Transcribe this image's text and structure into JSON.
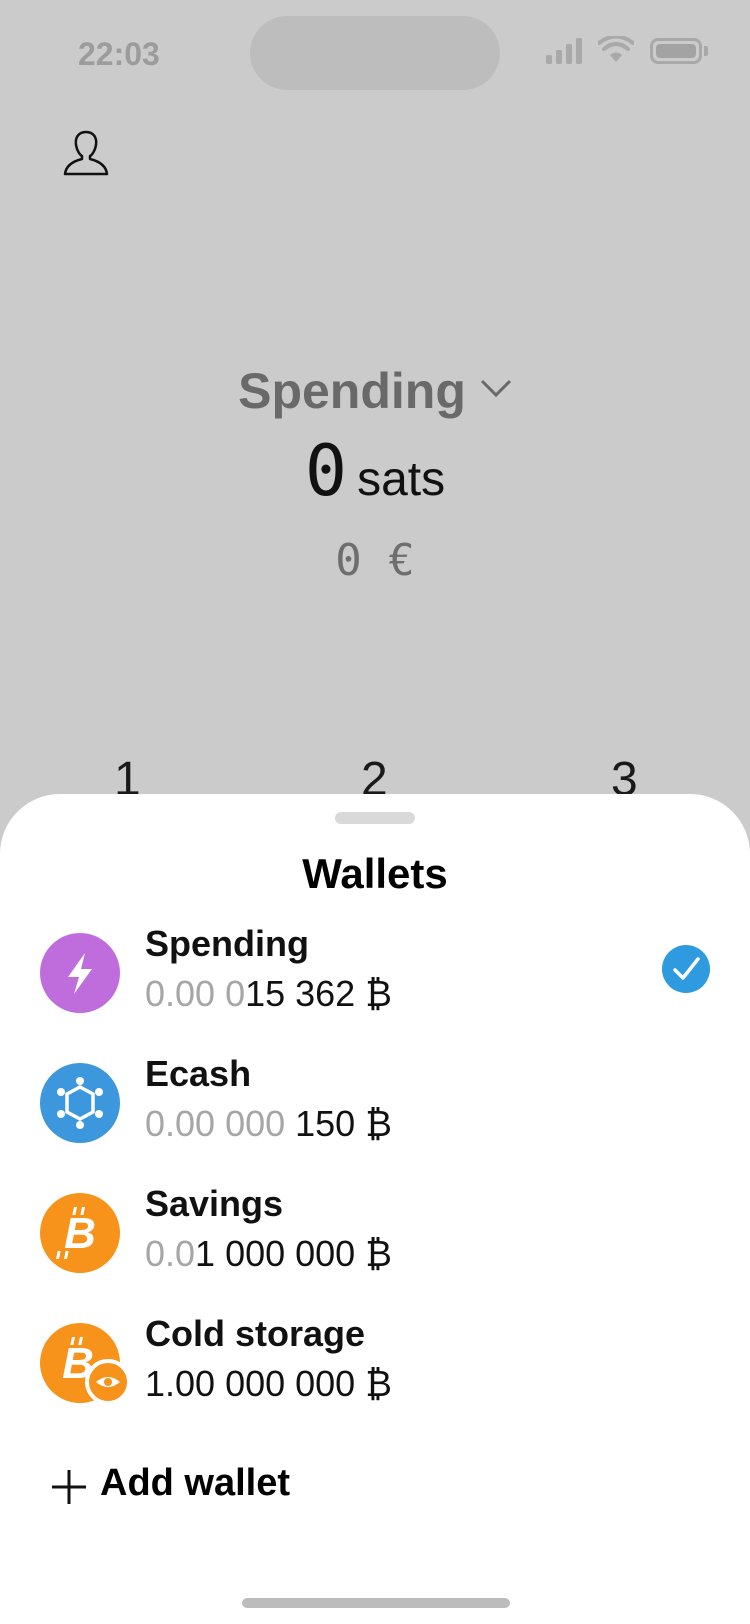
{
  "status_bar": {
    "time": "22:03"
  },
  "header": {
    "wallet_name": "Spending"
  },
  "balance": {
    "amount": "0",
    "unit": "sats",
    "fiat": "0 €"
  },
  "keypad": {
    "digits": [
      "1",
      "2",
      "3"
    ]
  },
  "sheet": {
    "title": "Wallets",
    "wallets": [
      {
        "name": "Spending",
        "amount_dim": "0.00 0",
        "amount_main": "15 362 ₿",
        "icon": "lightning-icon",
        "color": "#bf6ddc",
        "selected": true
      },
      {
        "name": "Ecash",
        "amount_dim": "0.00 000 ",
        "amount_main": "150 ₿",
        "icon": "ecash-icon",
        "color": "#3d97dd",
        "selected": false
      },
      {
        "name": "Savings",
        "amount_dim": "0.0",
        "amount_main": "1 000 000 ₿",
        "icon": "bitcoin-icon",
        "color": "#f7931a",
        "selected": false
      },
      {
        "name": "Cold storage",
        "amount_dim": "",
        "amount_main": "1.00 000 000 ₿",
        "icon": "bitcoin-watch-icon",
        "color": "#f7931a",
        "selected": false
      }
    ],
    "add_wallet_label": "Add wallet"
  },
  "colors": {
    "accent": "#2e9be0",
    "background": "#cbcbcb",
    "sheet": "#ffffff"
  }
}
